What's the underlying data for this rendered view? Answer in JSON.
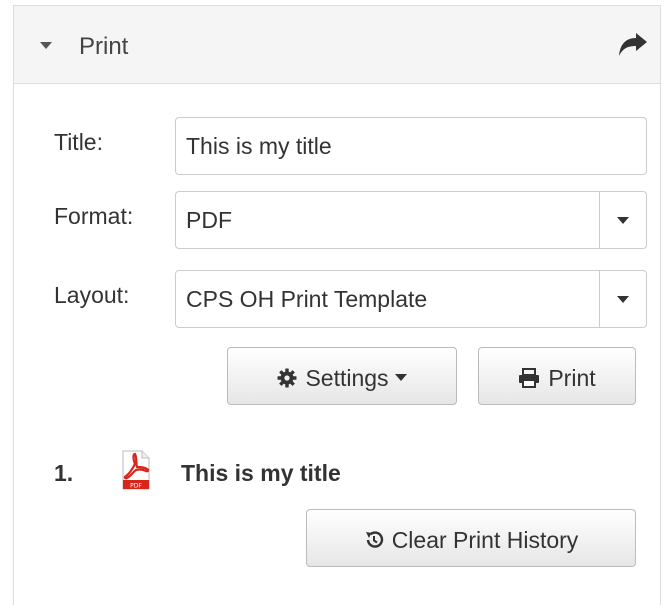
{
  "panel": {
    "title": "Print"
  },
  "form": {
    "title_label": "Title:",
    "title_value": "This is my title",
    "format_label": "Format:",
    "format_value": "PDF",
    "layout_label": "Layout:",
    "layout_value": "CPS OH Print Template"
  },
  "buttons": {
    "settings_label": "Settings",
    "print_label": "Print",
    "clear_history_label": "Clear Print History"
  },
  "history": {
    "items": [
      {
        "number": "1.",
        "title": "This is my title",
        "icon": "pdf-file-icon"
      }
    ]
  },
  "icons": {
    "collapse": "caret-down-icon",
    "share": "share-icon",
    "settings": "gear-icon",
    "print": "printer-icon",
    "clear": "history-icon"
  },
  "colors": {
    "heading_bg": "#f5f5f5",
    "border": "#dddddd",
    "pdf_red": "#d9261c"
  }
}
